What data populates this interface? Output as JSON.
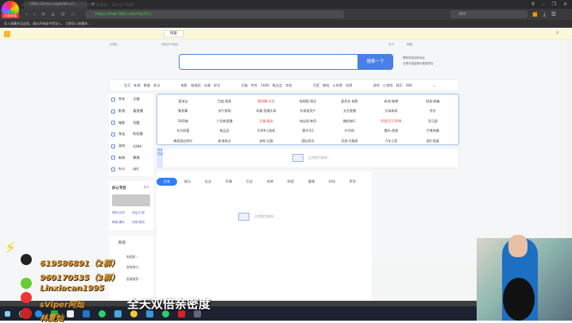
{
  "browser": {
    "logo_label": "白若体验",
    "tab_title": "https://www.wowuba.cn/...",
    "url": "https://hao.360.com/?a1111",
    "search_engine": "360",
    "bookmark_text": "导入收藏夹至这里。请从开始或书签导入。  立即导入收藏夹..."
  },
  "infobar": {
    "message": "360极速浏览器异常关闭，要恢复之前打开的网页，请点击\"恢复\"",
    "restore_label": "恢复"
  },
  "page": {
    "top_left": "[切换]",
    "top_mid": "添加天气地区...",
    "top_right": [
      "天气",
      "邮箱"
    ],
    "search_button": "搜索一下",
    "hints": [
      "帮助您找到好地址",
      "合规中国金融大数据风控"
    ],
    "nav": [
      [
        "首页",
        "新闻",
        "聚备",
        "热点"
      ],
      [
        "电影",
        "电视剧",
        "动漫",
        "综艺"
      ],
      [
        "天猫",
        "京东",
        "1688",
        "唯品会",
        "特卖"
      ],
      [
        "百度",
        "携程",
        "火车票",
        "机票"
      ],
      [
        "游戏",
        "小游戏",
        "娱乐",
        "888"
      ]
    ],
    "sidebar": [
      [
        "京东",
        "天猫"
      ],
      [
        "影视",
        "看直播"
      ],
      [
        "电影",
        "优酷"
      ],
      [
        "淘宝",
        "购优惠"
      ],
      [
        "游戏",
        "4399"
      ],
      [
        "新闻",
        "聚微"
      ],
      [
        "办公",
        "PPT"
      ]
    ],
    "links": [
      "爱淘宝",
      "百度·搜索",
      "聚划算·红包",
      "电视剧·演员",
      "爱奇艺·电影",
      "新浪·微博",
      "网易·邮箱",
      "聚划算",
      "苏宁易购",
      "凤凰·国漫头条",
      "东易易资产",
      "文艺直播",
      "头条新闻",
      "京东",
      "58同城",
      "六间房直播",
      "天猫·精选",
      "淘宝网·神奇",
      "携程旅行",
      "阿里巴巴1688",
      "亚马逊",
      "东方财富",
      "唯品会",
      "4399小游戏",
      "赛尔号2",
      "中华网",
      "腾讯·视频",
      "芒果热播",
      "携程酒店特价",
      "新浪热点",
      "游戏·出图",
      "国际资讯",
      "页游·开服表",
      "汽车之家",
      "图片频道"
    ],
    "red_links": [
      2,
      16,
      19
    ],
    "read_tag": "操作界面",
    "loading": "正在努力发现...",
    "office": {
      "title": "办公专区",
      "more": "更多›",
      "links": [
        "简历/合同",
        "总结/汇报",
        "教案/课件",
        "试卷/规划"
      ]
    },
    "channels": {
      "title": "频道",
      "items": [
        "电视剧 ›",
        "游戏排行 ›",
        "国漫推荐 ›"
      ]
    },
    "news_tabs": [
      "头条",
      "娱乐",
      "社会",
      "军事",
      "历史",
      "体育",
      "财经",
      "健康",
      "科技",
      "更多"
    ]
  },
  "overlay": {
    "qq1": "619586891（2群）",
    "qq2": "960170535（3群）",
    "wechat": "Linxiacan1995",
    "weibo": "sViper阿灿",
    "netease": "林夏灿",
    "subtitle": "全天双倍亲密度"
  },
  "colors": {
    "accent": "#4a7fe5",
    "overlay_text": "#d99a3a"
  }
}
